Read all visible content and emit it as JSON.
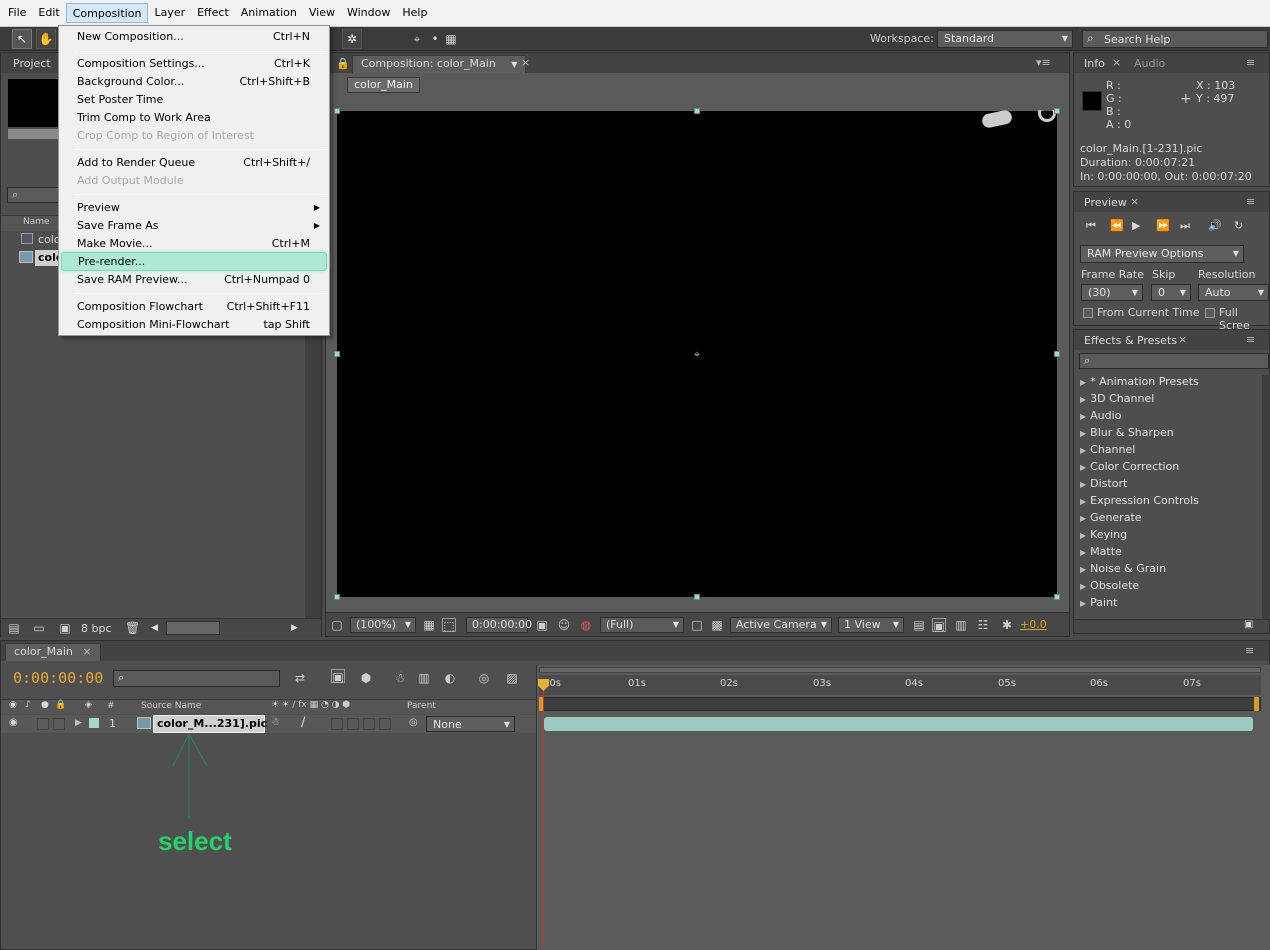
{
  "menubar": {
    "items": [
      "File",
      "Edit",
      "Composition",
      "Layer",
      "Effect",
      "Animation",
      "View",
      "Window",
      "Help"
    ],
    "active": "Composition"
  },
  "toolbar": {
    "workspace_label": "Workspace:",
    "workspace_value": "Standard",
    "search_placeholder": "Search Help"
  },
  "composition_menu": {
    "items": [
      {
        "label": "New Composition...",
        "shortcut": "Ctrl+N"
      },
      {
        "label": "Composition Settings...",
        "shortcut": "Ctrl+K"
      },
      {
        "label": "Background Color...",
        "shortcut": "Ctrl+Shift+B"
      },
      {
        "label": "Set Poster Time",
        "shortcut": ""
      },
      {
        "label": "Trim Comp to Work Area",
        "shortcut": ""
      },
      {
        "label": "Crop Comp to Region of Interest",
        "shortcut": ""
      },
      {
        "label": "Add to Render Queue",
        "shortcut": "Ctrl+Shift+/"
      },
      {
        "label": "Add Output Module",
        "shortcut": ""
      },
      {
        "label": "Preview",
        "shortcut": ""
      },
      {
        "label": "Save Frame As",
        "shortcut": ""
      },
      {
        "label": "Make Movie...",
        "shortcut": "Ctrl+M"
      },
      {
        "label": "Pre-render...",
        "shortcut": ""
      },
      {
        "label": "Save RAM Preview...",
        "shortcut": "Ctrl+Numpad 0"
      },
      {
        "label": "Composition Flowchart",
        "shortcut": "Ctrl+Shift+F11"
      },
      {
        "label": "Composition Mini-Flowchart",
        "shortcut": "tap Shift"
      }
    ]
  },
  "project_panel": {
    "tab": "Project",
    "col_name": "Name",
    "items": [
      "colo",
      "colo"
    ],
    "bpc": "8 bpc"
  },
  "comp_panel": {
    "tab": "Composition: color_Main",
    "breadcrumb": "color_Main"
  },
  "viewer_bar": {
    "zoom": "(100%)",
    "timecode": "0:00:00:00",
    "resolution": "(Full)",
    "camera": "Active Camera",
    "views": "1 View",
    "exposure": "+0.0"
  },
  "info_panel": {
    "tabs": [
      "Info",
      "Audio"
    ],
    "r": "R :",
    "g": "G :",
    "b": "B :",
    "a": "A : 0",
    "x": "X : 103",
    "y": "Y : 497",
    "file": "color_Main.[1-231].pic",
    "duration": "Duration: 0:00:07:21",
    "inout": "In: 0:00:00:00, Out: 0:00:07:20"
  },
  "preview_panel": {
    "tab": "Preview",
    "options": "RAM Preview Options",
    "frame_rate_label": "Frame Rate",
    "skip_label": "Skip",
    "resolution_label": "Resolution",
    "frame_rate": "(30)",
    "skip": "0",
    "resolution": "Auto",
    "from_current": "From Current Time",
    "full_screen": "Full Scree"
  },
  "effects_panel": {
    "tab": "Effects & Presets",
    "items": [
      "* Animation Presets",
      "3D Channel",
      "Audio",
      "Blur & Sharpen",
      "Channel",
      "Color Correction",
      "Distort",
      "Expression Controls",
      "Generate",
      "Keying",
      "Matte",
      "Noise & Grain",
      "Obsolete",
      "Paint"
    ]
  },
  "timeline": {
    "tab": "color_Main",
    "timecode": "0:00:00:00",
    "col_num": "#",
    "col_source": "Source Name",
    "col_parent": "Parent",
    "layer_num": "1",
    "layer_name": "color_M...231].pic",
    "parent_value": "None",
    "ruler": [
      "00s",
      "01s",
      "02s",
      "03s",
      "04s",
      "05s",
      "06s",
      "07s"
    ]
  },
  "annotation": {
    "text": "select",
    "color": "#22d36a"
  }
}
